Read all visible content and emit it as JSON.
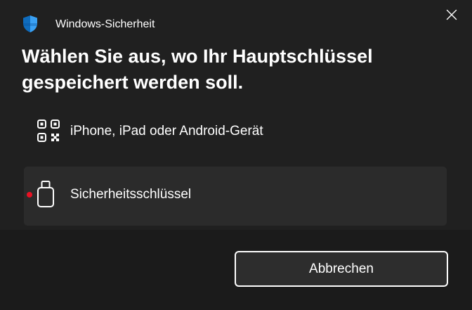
{
  "app": {
    "title": "Windows-Sicherheit",
    "icon": "shield-icon",
    "close_icon": "close-icon"
  },
  "heading": "Wählen Sie aus, wo Ihr Hauptschlüssel gespeichert werden soll.",
  "options": [
    {
      "label": "iPhone, iPad oder Android-Gerät",
      "icon": "qr-code-icon",
      "selected": false
    },
    {
      "label": "Sicherheitsschlüssel",
      "icon": "usb-security-key-icon",
      "selected": true
    }
  ],
  "footer": {
    "cancel_label": "Abbrechen"
  },
  "colors": {
    "background": "#202020",
    "footer_background": "#1b1b1b",
    "selected_option_background": "#2b2b2b",
    "indicator_dot": "#e81123",
    "shield_accent": "#0078d4"
  }
}
